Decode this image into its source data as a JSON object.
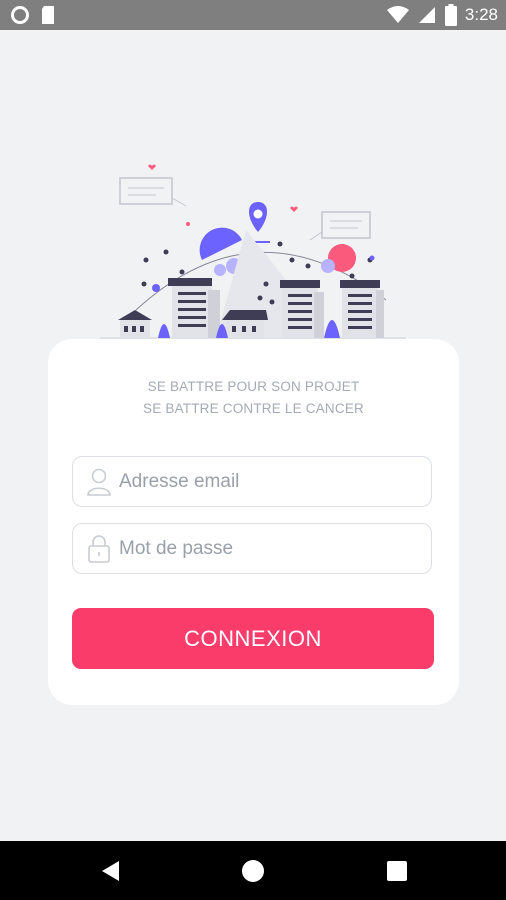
{
  "status_bar": {
    "time": "3:28",
    "icons": [
      "circle-icon",
      "sd-card-icon",
      "wifi-icon",
      "cellular-signal-icon",
      "battery-icon"
    ]
  },
  "illustration": {
    "description_icon": "city-illustration",
    "accent_colors": [
      "#6c63ff",
      "#fa5a7b",
      "#3f3d56"
    ]
  },
  "card": {
    "tagline_line1": "SE BATTRE POUR SON PROJET",
    "tagline_line2": "SE BATTRE CONTRE LE CANCER",
    "email": {
      "placeholder": "Adresse email",
      "value": ""
    },
    "password": {
      "placeholder": "Mot de passe",
      "value": ""
    },
    "login_label": "CONNEXION"
  },
  "colors": {
    "accent": "#fa3c6b",
    "background": "#f1f2f4",
    "card": "#ffffff"
  },
  "nav_bar": {
    "buttons": [
      "back-icon",
      "home-icon",
      "recents-icon"
    ]
  }
}
